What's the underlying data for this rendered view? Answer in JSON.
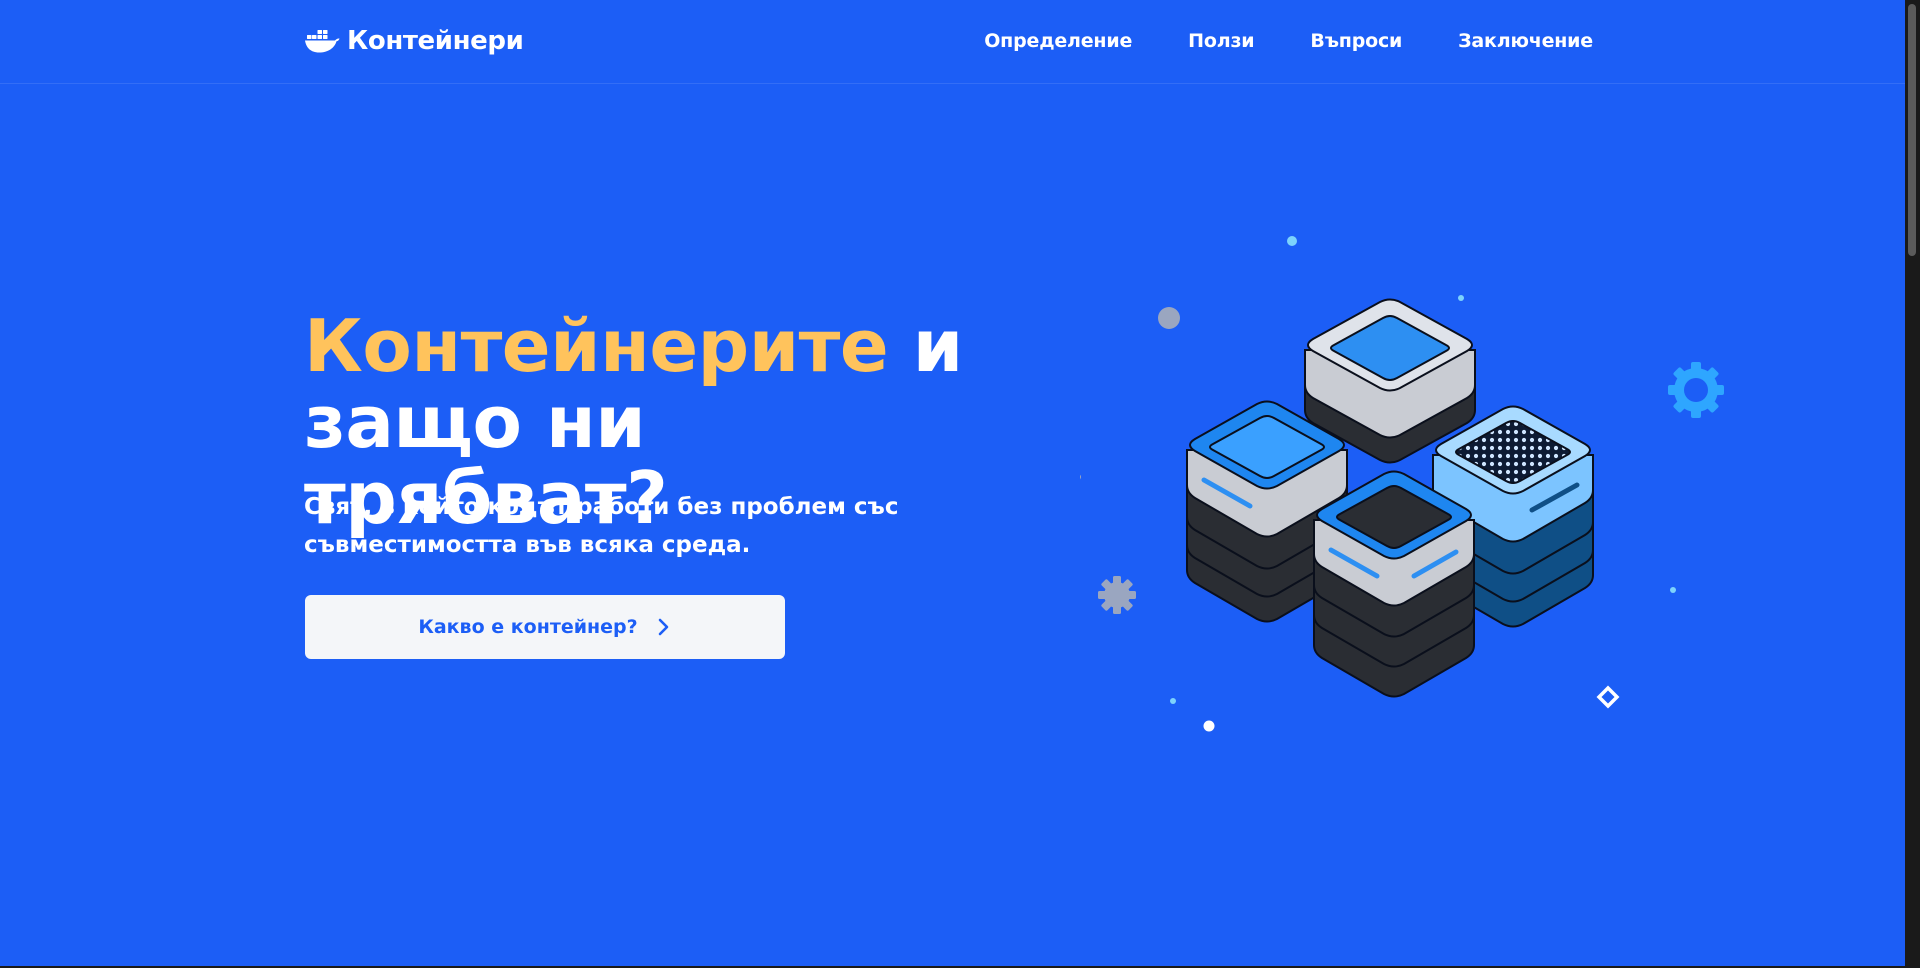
{
  "brand": {
    "name": "Контейнери",
    "icon": "whale-icon"
  },
  "nav": {
    "items": [
      {
        "label": "Определение"
      },
      {
        "label": "Ползи"
      },
      {
        "label": "Въпроси"
      },
      {
        "label": "Заключение"
      }
    ]
  },
  "hero": {
    "title_accent": "Контейнерите",
    "title_rest_1": " и",
    "title_rest_2": "защо ни трябват?",
    "subtitle": "Свят, в който кодът работи без проблем със съвместимостта във всяка среда.",
    "cta_label": "Какво е контейнер?",
    "cta_icon": "chevron-right-icon"
  },
  "colors": {
    "background": "#1c5ef6",
    "accent": "#ffc35c",
    "button_bg": "#f4f6f9",
    "button_text": "#1c5ef6"
  }
}
